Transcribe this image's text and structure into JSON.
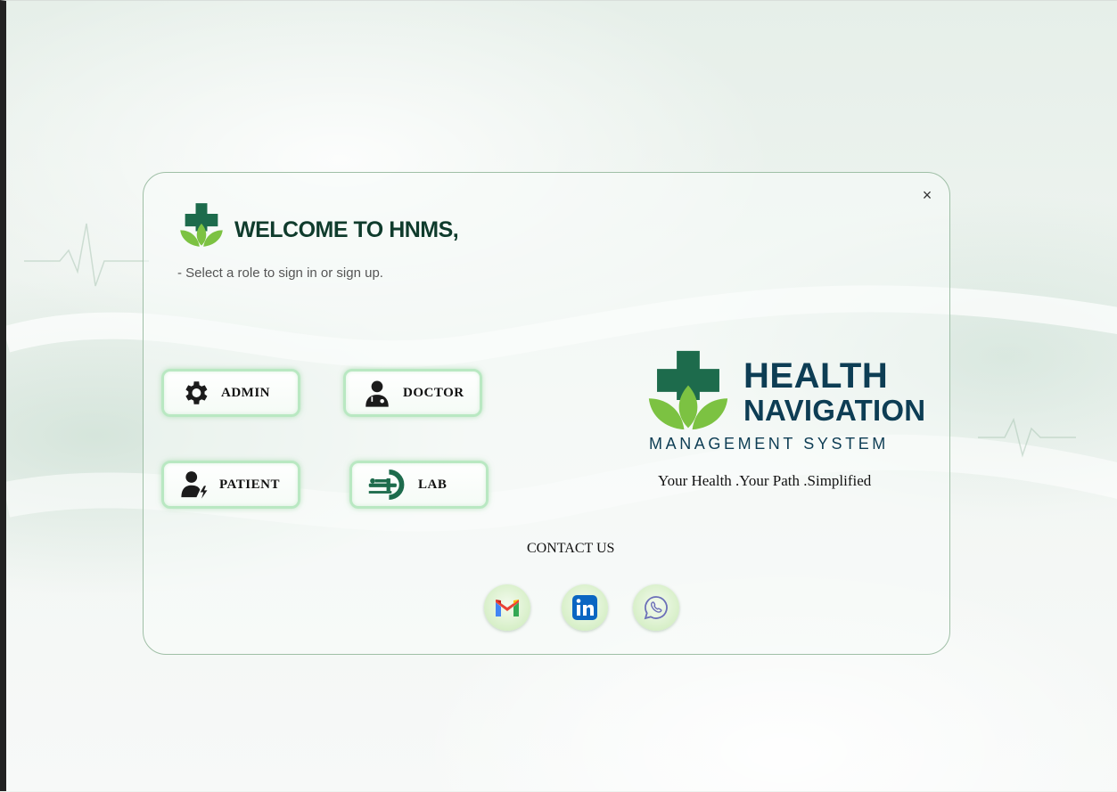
{
  "dialog": {
    "close_label": "×",
    "title": "WELCOME TO HNMS,",
    "subtitle": "- Select a role to sign in or sign up."
  },
  "roles": [
    {
      "label": "ADMIN",
      "icon": "gear-icon"
    },
    {
      "label": "DOCTOR",
      "icon": "doctor-icon"
    },
    {
      "label": "PATIENT",
      "icon": "patient-icon"
    },
    {
      "label": "LAB",
      "icon": "lab-scanner-icon"
    }
  ],
  "brand": {
    "line1": "HEALTH",
    "line2": "NAVIGATION",
    "line3": "MANAGEMENT SYSTEM",
    "tagline": "Your Health .Your Path .Simplified"
  },
  "contact": {
    "title": "CONTACT US",
    "links": [
      {
        "icon": "gmail-icon"
      },
      {
        "icon": "linkedin-icon"
      },
      {
        "icon": "whatsapp-icon"
      }
    ]
  },
  "colors": {
    "brand_green": "#1d6b4c",
    "leaf_green": "#7cc242",
    "brand_navy": "#0d3d54",
    "button_glow": "#b9e8c2"
  }
}
